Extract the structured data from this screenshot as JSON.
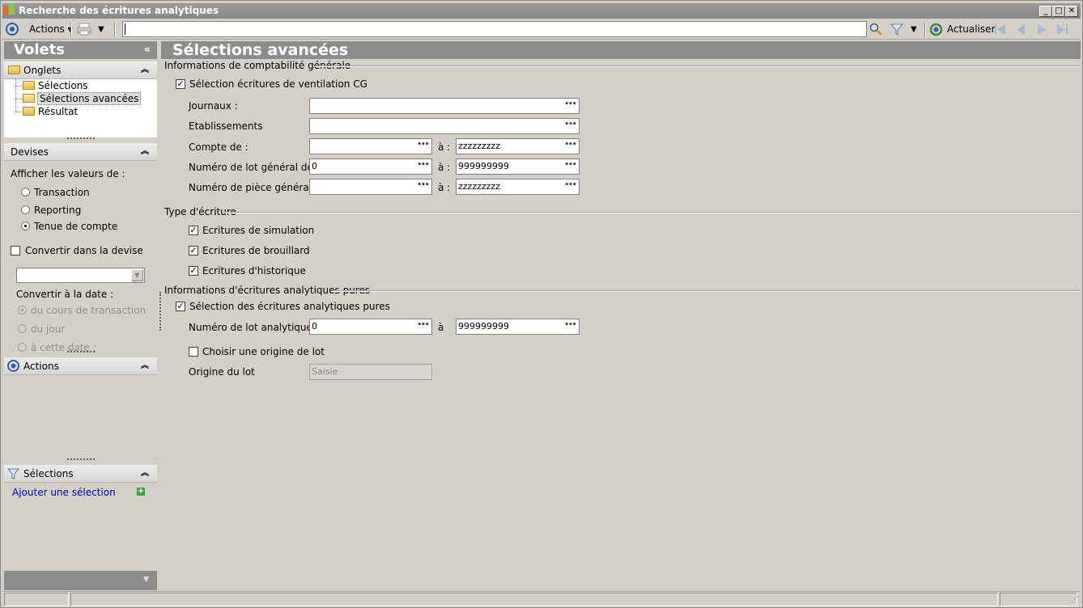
{
  "window": {
    "title": "Recherche des écritures analytiques"
  },
  "toolbar": {
    "actions_label": "Actions",
    "search_value": "",
    "refresh_label": "Actualiser"
  },
  "left": {
    "volets_title": "Volets",
    "onglets": {
      "title": "Onglets",
      "items": [
        "Sélections",
        "Sélections avancées",
        "Résultat"
      ],
      "selected": "Sélections avancées"
    },
    "devises": {
      "title": "Devises",
      "show_values_label": "Afficher les valeurs de :",
      "options": [
        "Transaction",
        "Reporting",
        "Tenue de compte"
      ],
      "selected": "Tenue de compte",
      "convert_label": "Convertir dans la devise",
      "convert_checked": false,
      "currency_value": "",
      "convert_date_label": "Convertir à la date :",
      "date_options": [
        "du cours de transaction",
        "du jour",
        "à cette date :"
      ],
      "date_selected": "du cours de transaction"
    },
    "actions": {
      "title": "Actions"
    },
    "selections": {
      "title": "Sélections",
      "add_label": "Ajouter une sélection"
    }
  },
  "main": {
    "title": "Sélections avancées",
    "general": {
      "group_label": "Informations de comptabilité générale",
      "cg_checkbox_label": "Sélection écritures de ventilation CG",
      "cg_checked": true,
      "journaux_label": "Journaux :",
      "journaux_value": "",
      "etablissements_label": "Etablissements",
      "etablissements_value": "",
      "compte_label": "Compte de :",
      "compte_from": "",
      "compte_to": "zzzzzzzzz",
      "lot_label": "Numéro de lot général de :",
      "lot_from": "0",
      "lot_to": "999999999",
      "piece_label": "Numéro de pièce générale de :",
      "piece_from": "",
      "piece_to": "zzzzzzzzz",
      "to_label": "à :"
    },
    "type": {
      "group_label": "Type d'écriture",
      "items": [
        "Ecritures de simulation",
        "Ecritures de brouillard",
        "Ecritures d'historique"
      ],
      "checked": [
        true,
        true,
        true
      ]
    },
    "analytic": {
      "group_label": "Informations d'écritures analytiques pures",
      "checkbox_label": "Sélection des écritures analytiques pures",
      "checked": true,
      "lot_label": "Numéro de lot analytique de  :",
      "lot_from": "0",
      "to_label": "à",
      "lot_to": "999999999",
      "origin_checkbox_label": "Choisir une origine de lot",
      "origin_checked": false,
      "origin_label": "Origine du lot",
      "origin_value": "Saisie"
    }
  }
}
